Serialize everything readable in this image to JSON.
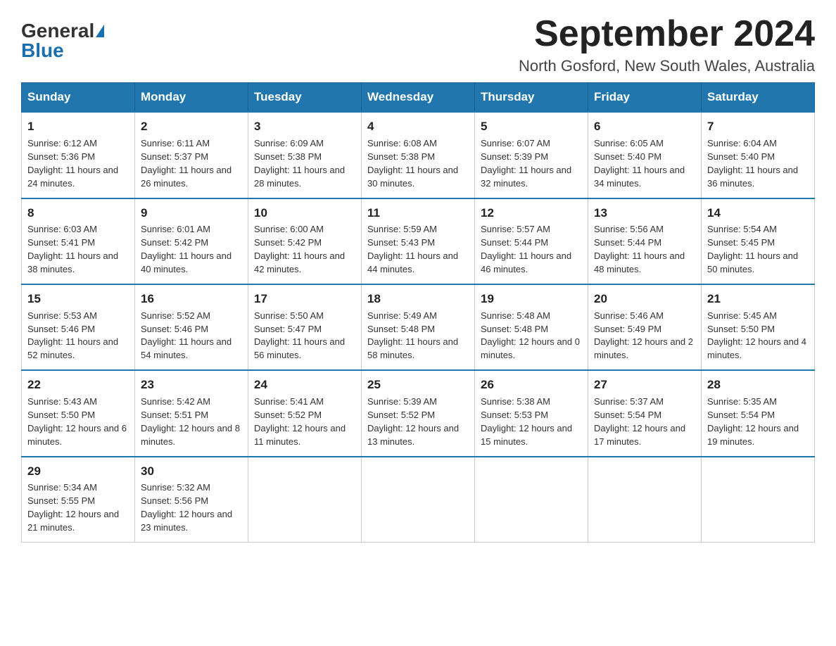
{
  "header": {
    "logo_general": "General",
    "logo_blue": "Blue",
    "month_title": "September 2024",
    "location": "North Gosford, New South Wales, Australia"
  },
  "weekdays": [
    "Sunday",
    "Monday",
    "Tuesday",
    "Wednesday",
    "Thursday",
    "Friday",
    "Saturday"
  ],
  "weeks": [
    [
      {
        "day": "1",
        "sunrise": "6:12 AM",
        "sunset": "5:36 PM",
        "daylight": "11 hours and 24 minutes."
      },
      {
        "day": "2",
        "sunrise": "6:11 AM",
        "sunset": "5:37 PM",
        "daylight": "11 hours and 26 minutes."
      },
      {
        "day": "3",
        "sunrise": "6:09 AM",
        "sunset": "5:38 PM",
        "daylight": "11 hours and 28 minutes."
      },
      {
        "day": "4",
        "sunrise": "6:08 AM",
        "sunset": "5:38 PM",
        "daylight": "11 hours and 30 minutes."
      },
      {
        "day": "5",
        "sunrise": "6:07 AM",
        "sunset": "5:39 PM",
        "daylight": "11 hours and 32 minutes."
      },
      {
        "day": "6",
        "sunrise": "6:05 AM",
        "sunset": "5:40 PM",
        "daylight": "11 hours and 34 minutes."
      },
      {
        "day": "7",
        "sunrise": "6:04 AM",
        "sunset": "5:40 PM",
        "daylight": "11 hours and 36 minutes."
      }
    ],
    [
      {
        "day": "8",
        "sunrise": "6:03 AM",
        "sunset": "5:41 PM",
        "daylight": "11 hours and 38 minutes."
      },
      {
        "day": "9",
        "sunrise": "6:01 AM",
        "sunset": "5:42 PM",
        "daylight": "11 hours and 40 minutes."
      },
      {
        "day": "10",
        "sunrise": "6:00 AM",
        "sunset": "5:42 PM",
        "daylight": "11 hours and 42 minutes."
      },
      {
        "day": "11",
        "sunrise": "5:59 AM",
        "sunset": "5:43 PM",
        "daylight": "11 hours and 44 minutes."
      },
      {
        "day": "12",
        "sunrise": "5:57 AM",
        "sunset": "5:44 PM",
        "daylight": "11 hours and 46 minutes."
      },
      {
        "day": "13",
        "sunrise": "5:56 AM",
        "sunset": "5:44 PM",
        "daylight": "11 hours and 48 minutes."
      },
      {
        "day": "14",
        "sunrise": "5:54 AM",
        "sunset": "5:45 PM",
        "daylight": "11 hours and 50 minutes."
      }
    ],
    [
      {
        "day": "15",
        "sunrise": "5:53 AM",
        "sunset": "5:46 PM",
        "daylight": "11 hours and 52 minutes."
      },
      {
        "day": "16",
        "sunrise": "5:52 AM",
        "sunset": "5:46 PM",
        "daylight": "11 hours and 54 minutes."
      },
      {
        "day": "17",
        "sunrise": "5:50 AM",
        "sunset": "5:47 PM",
        "daylight": "11 hours and 56 minutes."
      },
      {
        "day": "18",
        "sunrise": "5:49 AM",
        "sunset": "5:48 PM",
        "daylight": "11 hours and 58 minutes."
      },
      {
        "day": "19",
        "sunrise": "5:48 AM",
        "sunset": "5:48 PM",
        "daylight": "12 hours and 0 minutes."
      },
      {
        "day": "20",
        "sunrise": "5:46 AM",
        "sunset": "5:49 PM",
        "daylight": "12 hours and 2 minutes."
      },
      {
        "day": "21",
        "sunrise": "5:45 AM",
        "sunset": "5:50 PM",
        "daylight": "12 hours and 4 minutes."
      }
    ],
    [
      {
        "day": "22",
        "sunrise": "5:43 AM",
        "sunset": "5:50 PM",
        "daylight": "12 hours and 6 minutes."
      },
      {
        "day": "23",
        "sunrise": "5:42 AM",
        "sunset": "5:51 PM",
        "daylight": "12 hours and 8 minutes."
      },
      {
        "day": "24",
        "sunrise": "5:41 AM",
        "sunset": "5:52 PM",
        "daylight": "12 hours and 11 minutes."
      },
      {
        "day": "25",
        "sunrise": "5:39 AM",
        "sunset": "5:52 PM",
        "daylight": "12 hours and 13 minutes."
      },
      {
        "day": "26",
        "sunrise": "5:38 AM",
        "sunset": "5:53 PM",
        "daylight": "12 hours and 15 minutes."
      },
      {
        "day": "27",
        "sunrise": "5:37 AM",
        "sunset": "5:54 PM",
        "daylight": "12 hours and 17 minutes."
      },
      {
        "day": "28",
        "sunrise": "5:35 AM",
        "sunset": "5:54 PM",
        "daylight": "12 hours and 19 minutes."
      }
    ],
    [
      {
        "day": "29",
        "sunrise": "5:34 AM",
        "sunset": "5:55 PM",
        "daylight": "12 hours and 21 minutes."
      },
      {
        "day": "30",
        "sunrise": "5:32 AM",
        "sunset": "5:56 PM",
        "daylight": "12 hours and 23 minutes."
      },
      null,
      null,
      null,
      null,
      null
    ]
  ],
  "labels": {
    "sunrise": "Sunrise:",
    "sunset": "Sunset:",
    "daylight": "Daylight:"
  },
  "colors": {
    "header_bg": "#2176ae",
    "border": "#ccc"
  }
}
